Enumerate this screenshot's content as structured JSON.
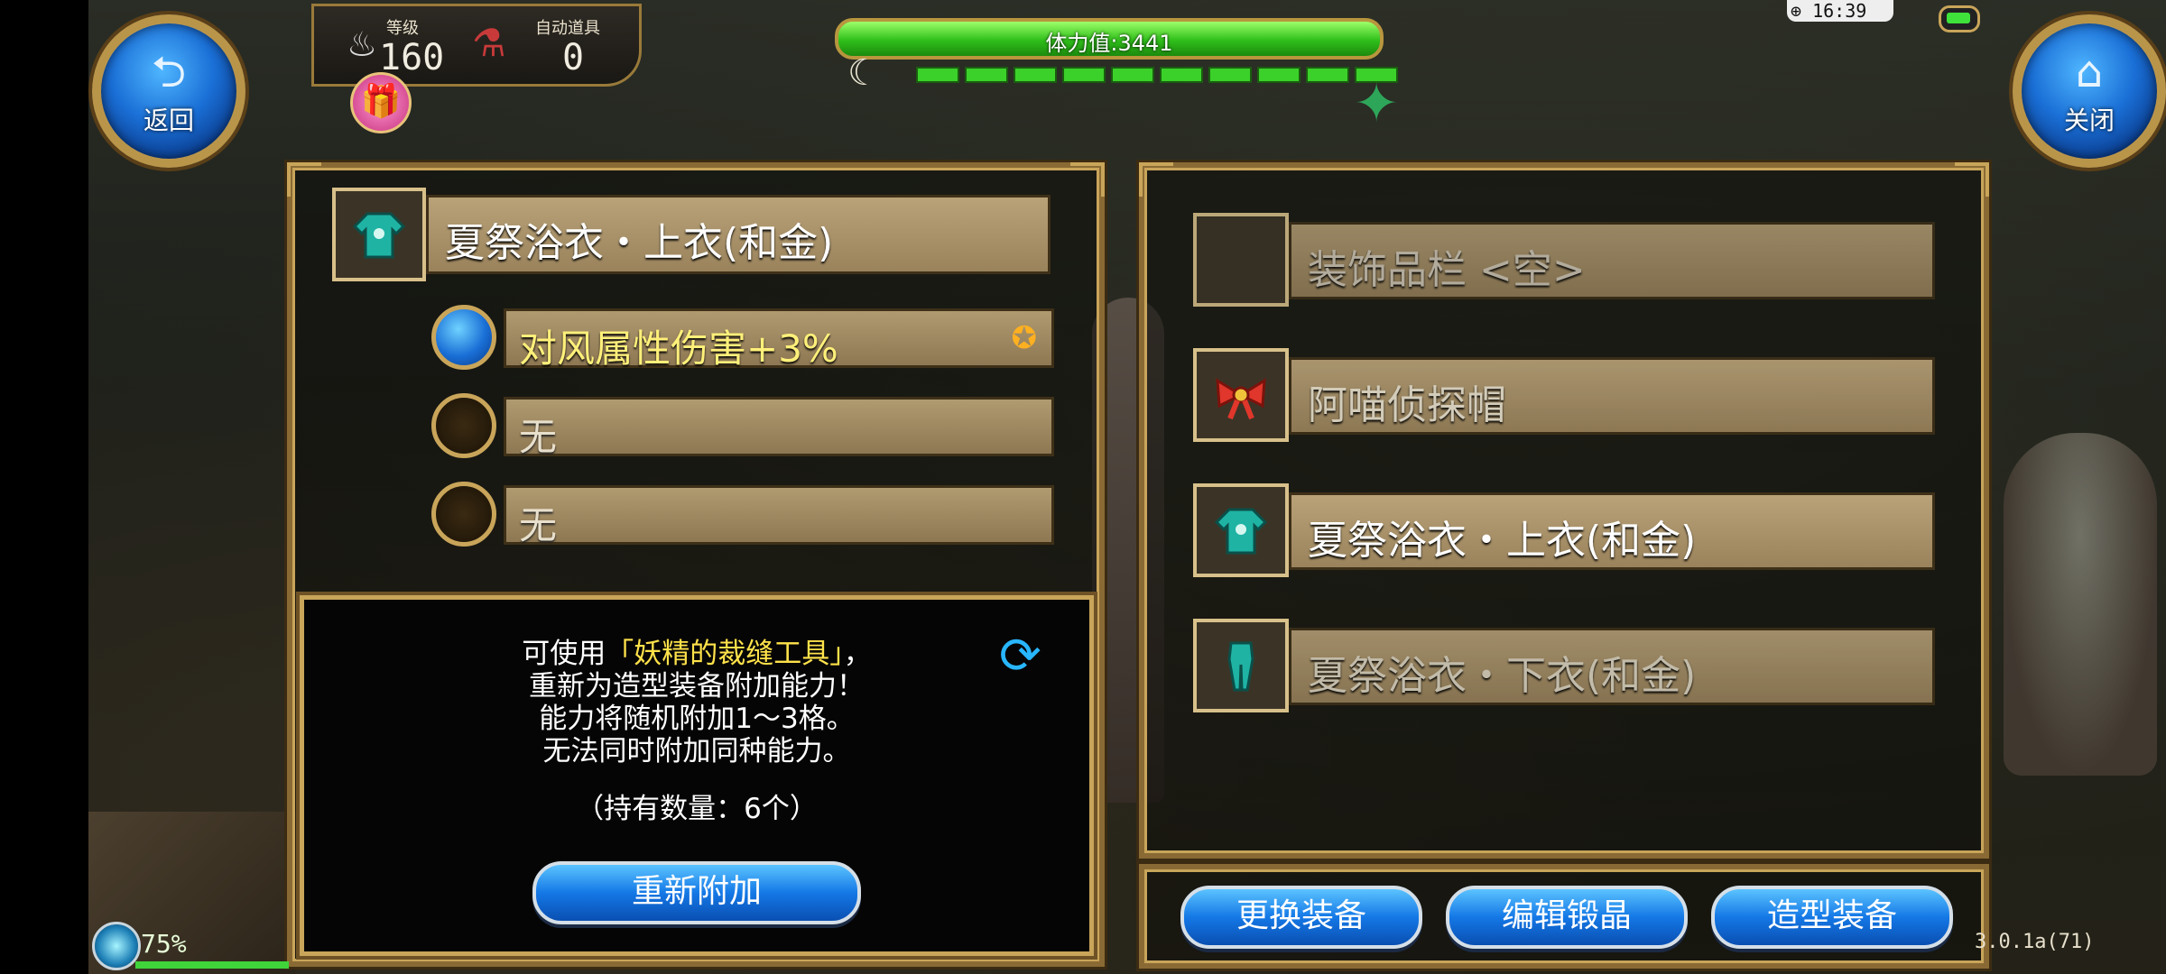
{
  "status": {
    "level_label": "等级",
    "level_value": "160",
    "auto_item_label": "自动道具",
    "auto_item_value": "0",
    "stamina_text": "体力值:3441",
    "clock": "16:39",
    "battery_percent": "75%",
    "version": "3.0.1a(71)"
  },
  "nav": {
    "back_label": "返回",
    "close_label": "关闭"
  },
  "left_panel": {
    "selected_item": "夏祭浴衣・上衣(和金)",
    "abilities": [
      {
        "text": "对风属性伤害+3%",
        "active": true
      },
      {
        "text": "无",
        "active": false
      },
      {
        "text": "无",
        "active": false
      }
    ],
    "info": {
      "line1_prefix": "可使用",
      "line1_tool": "「妖精的裁缝工具」",
      "line1_suffix": "，",
      "line2": "重新为造型装备附加能力！",
      "line3": "能力将随机附加1～3格。",
      "line4": "无法同时附加同种能力。",
      "line5": "（持有数量：6个）"
    },
    "reattach_button": "重新附加"
  },
  "right_panel": {
    "slots": [
      {
        "text": "装饰品栏 <空>",
        "icon": "empty-slot-icon"
      },
      {
        "text": "阿喵侦探帽",
        "icon": "bow-hat-icon"
      },
      {
        "text": "夏祭浴衣・上衣(和金)",
        "icon": "upper-garment-icon"
      },
      {
        "text": "夏祭浴衣・下衣(和金)",
        "icon": "lower-garment-icon"
      }
    ]
  },
  "bottom_buttons": {
    "change_equipment": "更换装备",
    "edit_crystal": "编辑锻晶",
    "costume_equipment": "造型装备"
  },
  "colors": {
    "gold_frame": "#c9a55a",
    "tool_yellow": "#ffe24a",
    "ability_yellow": "#fff07a",
    "button_blue": "#1478e6",
    "stamina_green": "#2fbf1a"
  }
}
